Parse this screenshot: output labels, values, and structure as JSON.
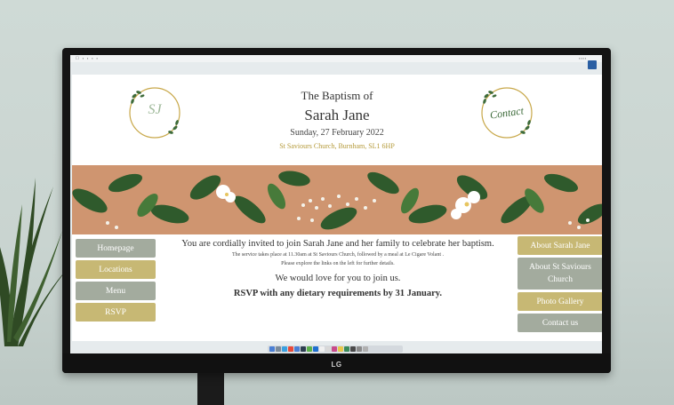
{
  "header": {
    "kicker": "The Baptism of",
    "name": "Sarah Jane",
    "date": "Sunday, 27 February 2022",
    "address": "St Saviours Church, Burnham, SL1 6HP",
    "monogram": "SJ",
    "contact_badge": "Contact"
  },
  "nav_left": [
    {
      "label": "Homepage",
      "color": "#a3ab9e"
    },
    {
      "label": "Locations",
      "color": "#c7b874"
    },
    {
      "label": "Menu",
      "color": "#a3ab9e"
    },
    {
      "label": "RSVP",
      "color": "#c7b874"
    }
  ],
  "nav_right": [
    {
      "label": "About Sarah Jane",
      "color": "#c7b874"
    },
    {
      "label": "About St Saviours Church",
      "color": "#a3ab9e"
    },
    {
      "label": "Photo Gallery",
      "color": "#c7b874"
    },
    {
      "label": "Contact us",
      "color": "#a3ab9e"
    }
  ],
  "body": {
    "intro": "You are cordially invited to join Sarah Jane and her family to celebrate her baptism.",
    "service": "The service takes place at 11.30am at St Saviours Church, followed by a meal at Le Cigare Volant .",
    "explore": "Please explore the links on the left for further details.",
    "love": "We would love for you to join us.",
    "rsvp": "RSVP with any dietary requirements by 31 January."
  },
  "monitor": {
    "brand": "LG"
  },
  "colors": {
    "sage": "#a3ab9e",
    "gold": "#c7b874",
    "address": "#b59a3a"
  }
}
